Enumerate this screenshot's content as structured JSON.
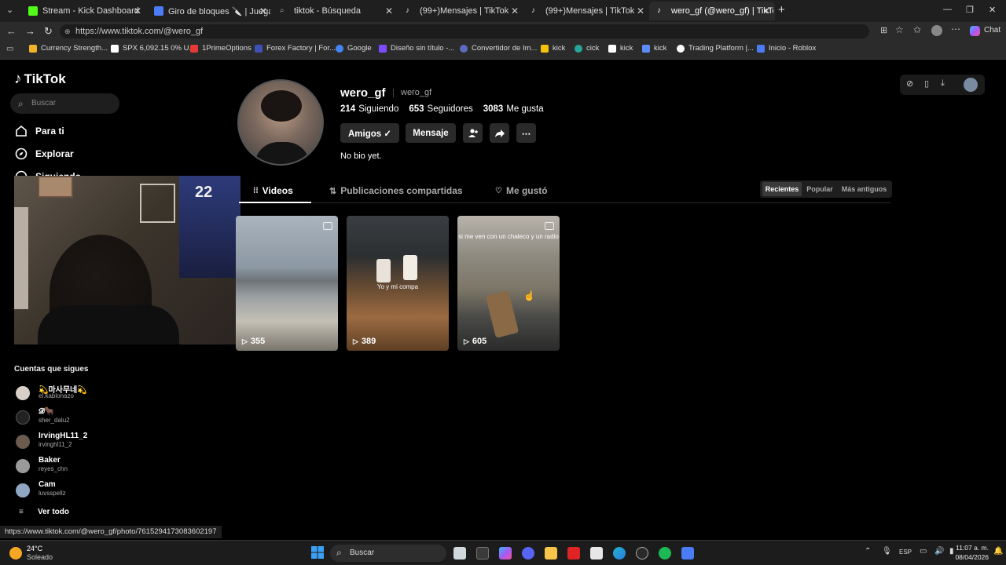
{
  "tabs": [
    {
      "label": "Stream - Kick Dashboard",
      "color": "#53fc18"
    },
    {
      "label": "Giro de bloques 🔪 | Juega en Roblox",
      "color": "#4a7cf7"
    },
    {
      "label": "tiktok - Búsqueda",
      "color": "#888888"
    },
    {
      "label": "(99+)Mensajes | TikTok",
      "color": "#ffffff"
    },
    {
      "label": "(99+)Mensajes | TikTok",
      "color": "#ffffff"
    },
    {
      "label": "wero_gf (@wero_gf) | TikTok",
      "color": "#ffffff"
    }
  ],
  "browser": {
    "url": "https://www.tiktok.com/@wero_gf",
    "chat_label": "Chat",
    "new_tab": "+",
    "close": "✕"
  },
  "bookmarks": [
    {
      "label": "Currency Strength...",
      "color": "#f0b429"
    },
    {
      "label": "SPX 6,092.15 0% U...",
      "color": "#ffffff"
    },
    {
      "label": "1PrimeOptions",
      "color": "#e53935"
    },
    {
      "label": "Forex Factory | For...",
      "color": "#3f51b5"
    },
    {
      "label": "Google",
      "color": "#4285f4"
    },
    {
      "label": "Diseño sin título -...",
      "color": "#7c4dff"
    },
    {
      "label": "Convertidor de Im...",
      "color": "#5c6bc0"
    },
    {
      "label": "kick",
      "color": "#f4c20d"
    },
    {
      "label": "cick",
      "color": "#26a69a"
    },
    {
      "label": "kick",
      "color": "#ffffff"
    },
    {
      "label": "kick",
      "color": "#5c8df6"
    },
    {
      "label": "Trading Platform |...",
      "color": "#ffffff"
    },
    {
      "label": "Inicio - Roblox",
      "color": "#4a7cf7"
    }
  ],
  "sidebar": {
    "logo": "TikTok",
    "search_placeholder": "Buscar",
    "nav": [
      {
        "label": "Para ti"
      },
      {
        "label": "Explorar"
      },
      {
        "label": "Siguiendo"
      }
    ],
    "following_title": "Cuentas que sigues",
    "accounts": [
      {
        "name": "💫마사무네💫",
        "handle": "el.kablonazo"
      },
      {
        "name": "𝓓🐂",
        "handle": "sher_dalu2"
      },
      {
        "name": "IrvingHL11_2",
        "handle": "irvinghl11_2"
      },
      {
        "name": "Baker",
        "handle": "reyes_chn"
      },
      {
        "name": "Cam",
        "handle": "luvsspellz"
      }
    ],
    "see_all": "Ver todo"
  },
  "profile": {
    "username": "wero_gf",
    "nickname": "wero_gf",
    "following_count": "214",
    "following_label": "Siguiendo",
    "followers_count": "653",
    "followers_label": "Seguidores",
    "likes_count": "3083",
    "likes_label": "Me gusta",
    "friends_btn": "Amigos ✓",
    "message_btn": "Mensaje",
    "bio": "No bio yet."
  },
  "content_tabs": {
    "videos": "Videos",
    "reposts": "Publicaciones compartidas",
    "liked": "Me gustó"
  },
  "sort": {
    "recent": "Recientes",
    "popular": "Popular",
    "oldest": "Más antiguos"
  },
  "videos": [
    {
      "views": "355",
      "caption": ""
    },
    {
      "views": "389",
      "caption": "Yo y mi compa"
    },
    {
      "views": "605",
      "caption": "si me ven con un chaleco y un radio"
    }
  ],
  "status_url": "https://www.tiktok.com/@wero_gf/photo/7615294173083602197",
  "taskbar": {
    "weather_temp": "24°C",
    "weather_desc": "Soleado",
    "search_label": "Buscar",
    "lang": "ESP",
    "time": "11:07 a. m.",
    "date": "08/04/2026"
  }
}
